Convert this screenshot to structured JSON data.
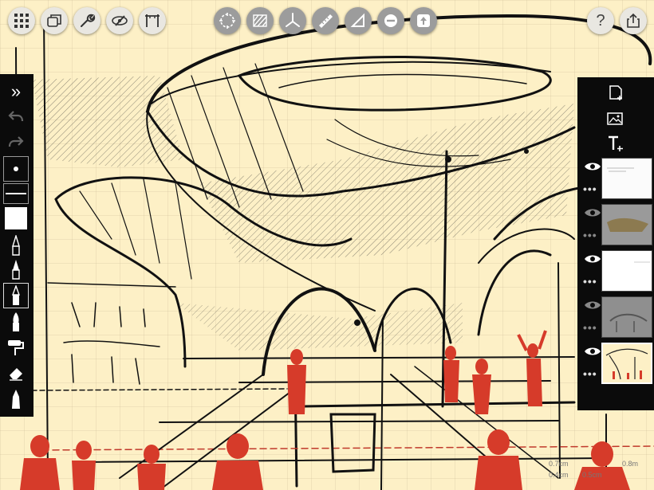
{
  "app": {
    "name": "Concepts sketching canvas"
  },
  "colors": {
    "paper": "#fdf0c6",
    "ink": "#111111",
    "accent_red": "#d63b2a",
    "panel": "#0b0b0b"
  },
  "toolbar_left": [
    {
      "name": "gallery",
      "icon": "grid-icon"
    },
    {
      "name": "layers-copy",
      "icon": "copy-icon"
    },
    {
      "name": "settings",
      "icon": "wrench-icon"
    },
    {
      "name": "view",
      "icon": "eye-orbit-icon"
    },
    {
      "name": "frame",
      "icon": "frame-icon"
    }
  ],
  "toolbar_center": [
    {
      "name": "selection",
      "icon": "lasso-icon"
    },
    {
      "name": "hatch",
      "icon": "hatch-icon"
    },
    {
      "name": "perspective",
      "icon": "axes-icon"
    },
    {
      "name": "ruler",
      "icon": "ruler-icon"
    },
    {
      "name": "triangle",
      "icon": "triangle-icon"
    },
    {
      "name": "measure",
      "icon": "measure-icon"
    },
    {
      "name": "nudge",
      "icon": "move-icon"
    }
  ],
  "toolbar_right": {
    "help_label": "?",
    "share_icon": "share-icon"
  },
  "left_strip": {
    "collapse_label": "»",
    "tools": [
      "pen-icon",
      "fine-liner-icon",
      "pencil-icon",
      "brush-icon",
      "airbrush-icon",
      "roller-icon",
      "eraser-icon",
      "marker-icon"
    ]
  },
  "right_panel": {
    "actions": [
      "new-layer-icon",
      "image-import-icon",
      "text-icon"
    ],
    "layers": [
      {
        "visible": true,
        "thumb": "sketch-light",
        "selected": false
      },
      {
        "visible": true,
        "thumb": "sketch-gray",
        "selected": false
      },
      {
        "visible": true,
        "thumb": "sketch-blank",
        "selected": false
      },
      {
        "visible": true,
        "thumb": "sketch-dark",
        "selected": false
      },
      {
        "visible": true,
        "thumb": "sketch-color",
        "selected": true
      }
    ]
  },
  "scale_readout": {
    "a": "0.7cm",
    "b": "0.4cm",
    "c": "0.5cm",
    "d": "0.8m"
  }
}
